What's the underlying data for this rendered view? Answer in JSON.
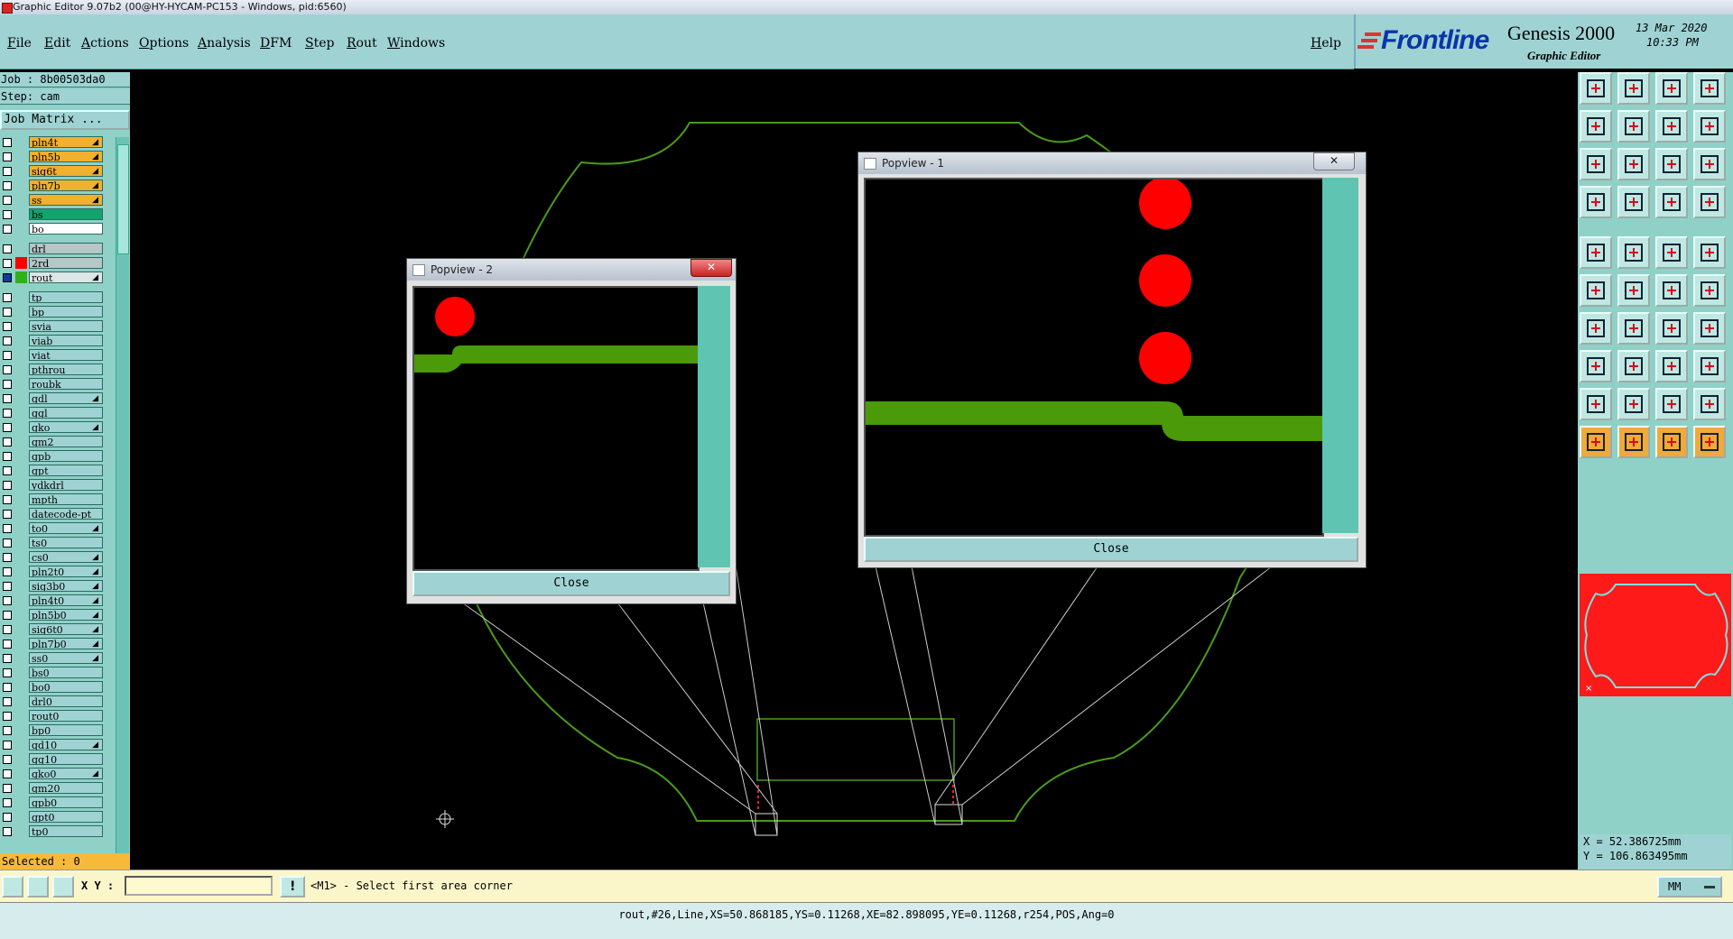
{
  "window": {
    "title": "Graphic Editor 9.07b2 (00@HY-HYCAM-PC153 - Windows, pid:6560)"
  },
  "menu": {
    "items": [
      "File",
      "Edit",
      "Actions",
      "Options",
      "Analysis",
      "DFM",
      "Step",
      "Rout",
      "Windows"
    ],
    "help": "Help"
  },
  "brand": {
    "logo": "Frontline",
    "product": "Genesis 2000",
    "subtitle": "Graphic Editor",
    "date": "13 Mar 2020",
    "time": "10:33 PM"
  },
  "job": {
    "job_label": "Job : 8b00503da0",
    "step_label": "Step: cam",
    "matrix_button": "Job Matrix ..."
  },
  "layers": [
    {
      "name": "pln4t",
      "color": "#f1b02e",
      "mark": true
    },
    {
      "name": "pln5b",
      "color": "#f1b02e",
      "mark": true
    },
    {
      "name": "sig6t",
      "color": "#f1b02e",
      "mark": true
    },
    {
      "name": "pln7b",
      "color": "#f1b02e",
      "mark": true
    },
    {
      "name": "ss",
      "color": "#f1b02e",
      "mark": true
    },
    {
      "name": "bs",
      "color": "#13a36d",
      "mark": false
    },
    {
      "name": "bo",
      "color": "#ffffff",
      "mark": false
    },
    {
      "gap": true
    },
    {
      "name": "drl",
      "color": "#b7c6c6",
      "mark": false
    },
    {
      "name": "2rd",
      "color": "#b7c6c6",
      "swatch": "#ff0000",
      "mark": false
    },
    {
      "name": "rout",
      "color": "#dde6e6",
      "swatch": "#32b01a",
      "mark": true,
      "active": true
    },
    {
      "gap": true
    },
    {
      "name": "tp",
      "color": "#9fd3d3",
      "mark": false
    },
    {
      "name": "bp",
      "color": "#9fd3d3",
      "mark": false
    },
    {
      "name": "svia",
      "color": "#9fd3d3",
      "mark": false
    },
    {
      "name": "viab",
      "color": "#9fd3d3",
      "mark": false
    },
    {
      "name": "viat",
      "color": "#9fd3d3",
      "mark": false
    },
    {
      "name": "pthrou",
      "color": "#9fd3d3",
      "mark": false
    },
    {
      "name": "roubk",
      "color": "#9fd3d3",
      "mark": false
    },
    {
      "name": "gdl",
      "color": "#9fd3d3",
      "mark": true
    },
    {
      "name": "ggl",
      "color": "#9fd3d3",
      "mark": false
    },
    {
      "name": "gko",
      "color": "#9fd3d3",
      "mark": true
    },
    {
      "name": "gm2",
      "color": "#9fd3d3",
      "mark": false
    },
    {
      "name": "gpb",
      "color": "#9fd3d3",
      "mark": false
    },
    {
      "name": "gpt",
      "color": "#9fd3d3",
      "mark": false
    },
    {
      "name": "ydkdrl",
      "color": "#9fd3d3",
      "mark": false
    },
    {
      "name": "mpth",
      "color": "#9fd3d3",
      "mark": false
    },
    {
      "name": "datecode-pt",
      "color": "#9fd3d3",
      "mark": false
    },
    {
      "name": "to0",
      "color": "#9fd3d3",
      "mark": true
    },
    {
      "name": "ts0",
      "color": "#9fd3d3",
      "mark": false
    },
    {
      "name": "cs0",
      "color": "#9fd3d3",
      "mark": true
    },
    {
      "name": "pln2t0",
      "color": "#9fd3d3",
      "mark": true
    },
    {
      "name": "sig3b0",
      "color": "#9fd3d3",
      "mark": true
    },
    {
      "name": "pln4t0",
      "color": "#9fd3d3",
      "mark": true
    },
    {
      "name": "pln5b0",
      "color": "#9fd3d3",
      "mark": true
    },
    {
      "name": "sig6t0",
      "color": "#9fd3d3",
      "mark": true
    },
    {
      "name": "pln7b0",
      "color": "#9fd3d3",
      "mark": true
    },
    {
      "name": "ss0",
      "color": "#9fd3d3",
      "mark": true
    },
    {
      "name": "bs0",
      "color": "#9fd3d3",
      "mark": false
    },
    {
      "name": "bo0",
      "color": "#9fd3d3",
      "mark": false
    },
    {
      "name": "drl0",
      "color": "#9fd3d3",
      "mark": false
    },
    {
      "name": "rout0",
      "color": "#9fd3d3",
      "mark": false
    },
    {
      "name": "bp0",
      "color": "#9fd3d3",
      "mark": false
    },
    {
      "name": "gd10",
      "color": "#9fd3d3",
      "mark": true
    },
    {
      "name": "gg10",
      "color": "#9fd3d3",
      "mark": false
    },
    {
      "name": "gko0",
      "color": "#9fd3d3",
      "mark": true
    },
    {
      "name": "gm20",
      "color": "#9fd3d3",
      "mark": false
    },
    {
      "name": "gpb0",
      "color": "#9fd3d3",
      "mark": false
    },
    {
      "name": "gpt0",
      "color": "#9fd3d3",
      "mark": false
    },
    {
      "name": "tp0",
      "color": "#9fd3d3",
      "mark": false
    }
  ],
  "selected": "Selected : 0",
  "popview2": {
    "title": "Popview - 2",
    "close": "Close"
  },
  "popview1": {
    "title": "Popview - 1",
    "close": "Close"
  },
  "coords": {
    "x": "X = 52.386725mm",
    "y": "Y = 106.863495mm"
  },
  "command": {
    "xy_label": "X Y :",
    "xy_value": "",
    "prompt": "<M1> - Select first area corner",
    "units": "MM"
  },
  "status": "rout,#26,Line,XS=50.868185,YS=0.11268,XE=82.898095,YE=0.11268,r254,POS,Ang=0",
  "colors": {
    "panel": "#9fd3d3",
    "teal": "#8fd1c6",
    "orange": "#f1b02e",
    "pad": "#ff0000",
    "trace": "#4a9a0a"
  }
}
